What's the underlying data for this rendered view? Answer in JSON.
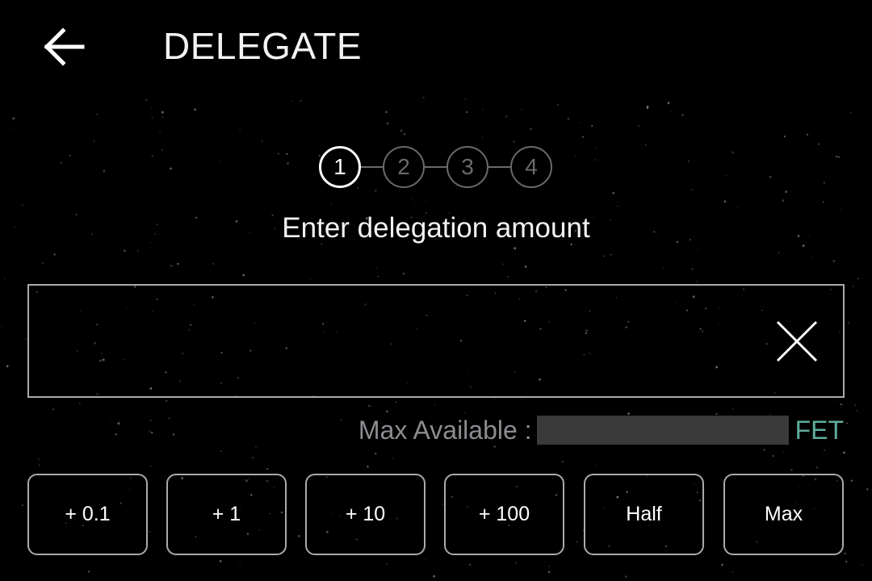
{
  "header": {
    "title": "DELEGATE",
    "back_icon": "arrow-left-icon"
  },
  "stepper": {
    "steps": [
      "1",
      "2",
      "3",
      "4"
    ],
    "active_step": 1
  },
  "form": {
    "instruction": "Enter delegation amount",
    "amount_value": "",
    "clear_icon": "close-icon",
    "max_available_label": "Max Available :",
    "max_available_value": "",
    "max_available_unit": "FET"
  },
  "quick_amounts": [
    "+ 0.1",
    "+ 1",
    "+ 10",
    "+ 100",
    "Half",
    "Max"
  ],
  "colors": {
    "background": "#000000",
    "border": "#a9aaae",
    "muted_text": "#8c8d91",
    "accent": "#5fae9c",
    "inactive_step": "#6a6a6a"
  }
}
